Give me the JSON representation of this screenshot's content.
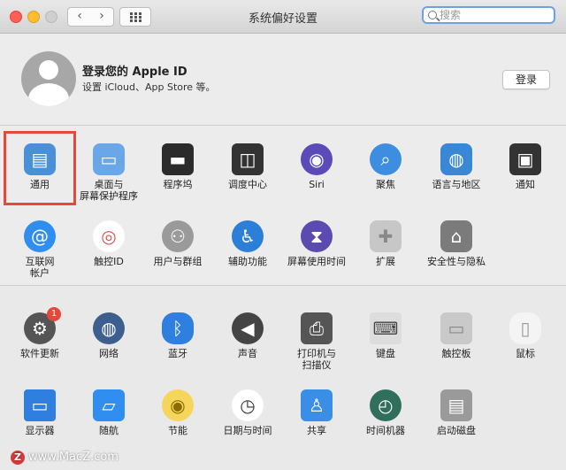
{
  "window": {
    "title": "系统偏好设置"
  },
  "search": {
    "placeholder": "搜索",
    "value": ""
  },
  "nav": {
    "back_glyph": "‹",
    "forward_glyph": "›"
  },
  "account": {
    "title": "登录您的 Apple ID",
    "subtitle": "设置 iCloud、App Store 等。",
    "login_label": "登录"
  },
  "colors": {
    "selection": "#e24a3b",
    "search_focus": "#6ea0e6",
    "badge": "#e8463b"
  },
  "section1": [
    {
      "label": "通用",
      "icon": "general-icon",
      "selected": true
    },
    {
      "label": "桌面与\n屏幕保护程序",
      "icon": "desktop-screensaver-icon"
    },
    {
      "label": "程序坞",
      "icon": "dock-icon"
    },
    {
      "label": "调度中心",
      "icon": "mission-control-icon"
    },
    {
      "label": "Siri",
      "icon": "siri-icon"
    },
    {
      "label": "聚焦",
      "icon": "spotlight-icon"
    },
    {
      "label": "语言与地区",
      "icon": "language-region-icon"
    },
    {
      "label": "通知",
      "icon": "notifications-icon"
    },
    {
      "label": "互联网\n帐户",
      "icon": "internet-accounts-icon"
    },
    {
      "label": "触控ID",
      "icon": "touch-id-icon"
    },
    {
      "label": "用户与群组",
      "icon": "users-groups-icon"
    },
    {
      "label": "辅助功能",
      "icon": "accessibility-icon"
    },
    {
      "label": "屏幕使用时间",
      "icon": "screen-time-icon"
    },
    {
      "label": "扩展",
      "icon": "extensions-icon"
    },
    {
      "label": "安全性与隐私",
      "icon": "security-privacy-icon"
    }
  ],
  "section2": [
    {
      "label": "软件更新",
      "icon": "software-update-icon",
      "badge": "1"
    },
    {
      "label": "网络",
      "icon": "network-icon"
    },
    {
      "label": "蓝牙",
      "icon": "bluetooth-icon"
    },
    {
      "label": "声音",
      "icon": "sound-icon"
    },
    {
      "label": "打印机与\n扫描仪",
      "icon": "printers-scanners-icon"
    },
    {
      "label": "键盘",
      "icon": "keyboard-icon"
    },
    {
      "label": "触控板",
      "icon": "trackpad-icon"
    },
    {
      "label": "鼠标",
      "icon": "mouse-icon"
    },
    {
      "label": "显示器",
      "icon": "displays-icon"
    },
    {
      "label": "随航",
      "icon": "sidecar-icon"
    },
    {
      "label": "节能",
      "icon": "energy-saver-icon"
    },
    {
      "label": "日期与时间",
      "icon": "date-time-icon"
    },
    {
      "label": "共享",
      "icon": "sharing-icon"
    },
    {
      "label": "时间机器",
      "icon": "time-machine-icon"
    },
    {
      "label": "启动磁盘",
      "icon": "startup-disk-icon"
    }
  ],
  "watermark": {
    "logo": "Z",
    "text": "www.MacZ.com"
  }
}
